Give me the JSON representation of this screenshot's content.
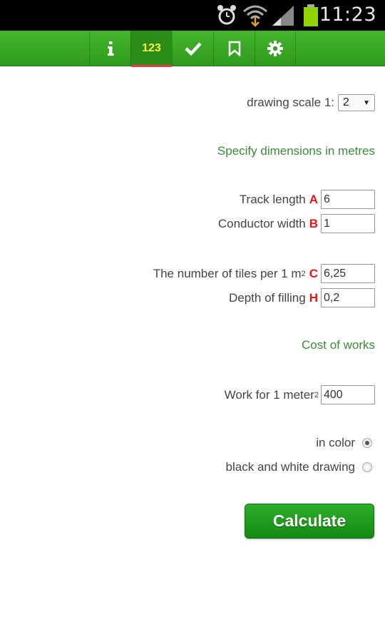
{
  "status_bar": {
    "time": "11:23",
    "icons": [
      "alarm-icon",
      "wifi-icon",
      "signal-icon",
      "battery-icon"
    ]
  },
  "toolbar": {
    "tabs": [
      {
        "icon": "info-icon",
        "label": ""
      },
      {
        "icon": "numbers-icon",
        "label": "123",
        "active": true
      },
      {
        "icon": "check-icon",
        "label": ""
      },
      {
        "icon": "bookmark-icon",
        "label": ""
      },
      {
        "icon": "gear-icon",
        "label": ""
      }
    ],
    "accent": "#e03a3a"
  },
  "form": {
    "scale_label": "drawing scale 1:",
    "scale_value": "2",
    "dims_heading": "Specify dimensions in metres",
    "track_length": {
      "label": "Track length",
      "letter": "A",
      "value": "6"
    },
    "conductor_width": {
      "label": "Conductor width",
      "letter": "B",
      "value": "1"
    },
    "tiles_per_m2": {
      "label": "The number of tiles per 1 m",
      "sup": "2",
      "letter": "C",
      "value": "6,25"
    },
    "filling_depth": {
      "label": "Depth of filling",
      "letter": "H",
      "value": "0,2"
    },
    "cost_heading": "Cost of works",
    "work_per_m2": {
      "label": "Work for 1 meter",
      "sup": "2",
      "value": "400"
    },
    "color_option": {
      "label": "in color",
      "checked": true
    },
    "bw_option": {
      "label": "black and white drawing",
      "checked": false
    },
    "calculate_label": "Calculate"
  },
  "colors": {
    "toolbar_green": "#3aa825",
    "heading_green": "#3b8a3b",
    "letter_red": "#e01818",
    "button_green": "#1f9c1d"
  }
}
